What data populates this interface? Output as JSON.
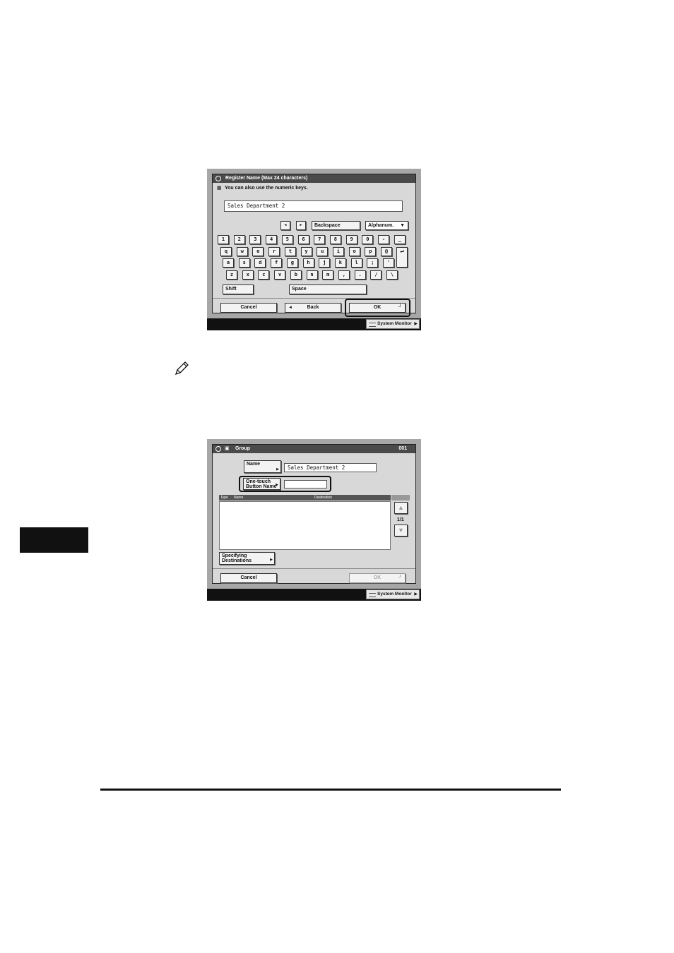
{
  "register_screen": {
    "title": "Register Name (Max 24 characters)",
    "hint": "You can also use the numeric keys.",
    "input_value": "Sales Department 2",
    "left_arrow": "◄",
    "right_arrow": "►",
    "backspace": "Backspace",
    "mode": "Alphanum.",
    "keys_row1": [
      "1",
      "2",
      "3",
      "4",
      "5",
      "6",
      "7",
      "8",
      "9",
      "0",
      "-",
      "_"
    ],
    "keys_row2": [
      "q",
      "w",
      "e",
      "r",
      "t",
      "y",
      "u",
      "i",
      "o",
      "p",
      "@"
    ],
    "keys_row3": [
      "a",
      "s",
      "d",
      "f",
      "g",
      "h",
      "j",
      "k",
      "l",
      ";",
      "'"
    ],
    "keys_row4": [
      "z",
      "x",
      "c",
      "v",
      "b",
      "n",
      "m",
      ",",
      ".",
      "/",
      "\\"
    ],
    "shift": "Shift",
    "space": "Space",
    "cancel": "Cancel",
    "back": "Back",
    "ok": "OK",
    "system_monitor": "System Monitor"
  },
  "group_screen": {
    "title": "Group",
    "number": "001",
    "name_button": "Name",
    "name_value": "Sales Department 2",
    "one_touch_button_line1": "One-touch",
    "one_touch_button_line2": "Button Name",
    "one_touch_value": "",
    "col_type": "Type",
    "col_name": "Name",
    "col_destination": "Destination",
    "page": "1/1",
    "specifying_line1": "Specifying",
    "specifying_line2": "Destinations",
    "cancel": "Cancel",
    "ok": "OK",
    "system_monitor": "System Monitor"
  }
}
